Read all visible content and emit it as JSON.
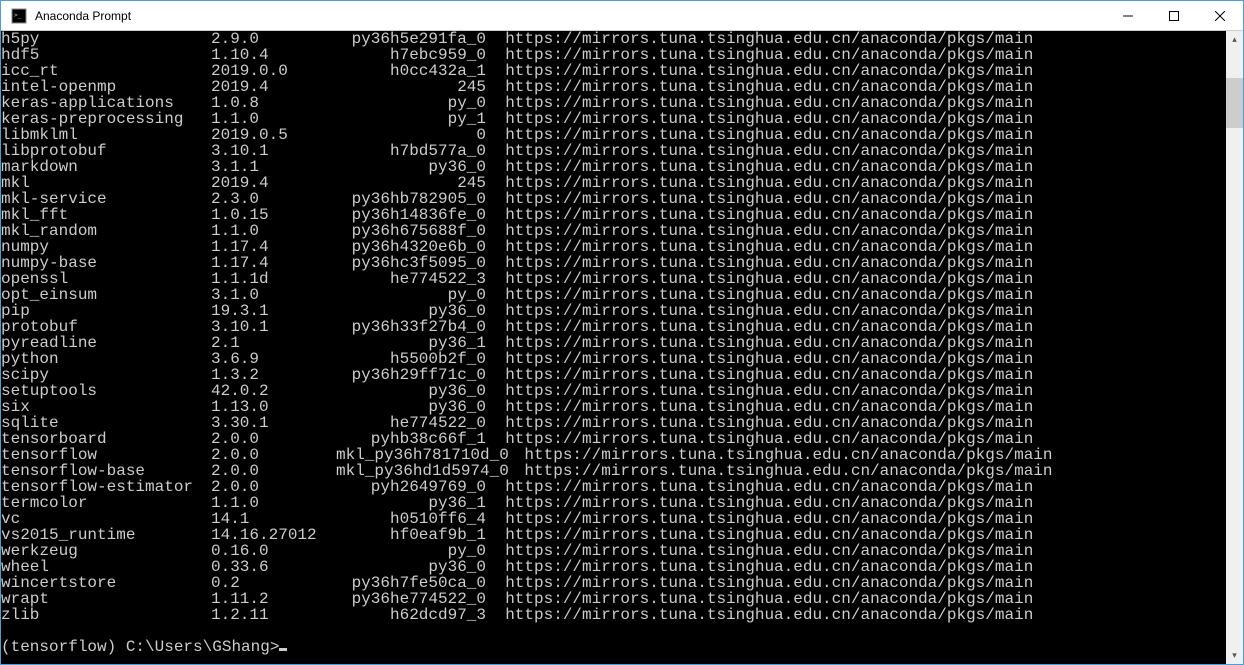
{
  "window": {
    "title": "Anaconda Prompt"
  },
  "packages": [
    {
      "name": "h5py",
      "version": "2.9.0",
      "build": "py36h5e291fa_0",
      "url": "  https://mirrors.tuna.tsinghua.edu.cn/anaconda/pkgs/main"
    },
    {
      "name": "hdf5",
      "version": "1.10.4",
      "build": "h7ebc959_0",
      "url": "  https://mirrors.tuna.tsinghua.edu.cn/anaconda/pkgs/main"
    },
    {
      "name": "icc_rt",
      "version": "2019.0.0",
      "build": "h0cc432a_1",
      "url": "  https://mirrors.tuna.tsinghua.edu.cn/anaconda/pkgs/main"
    },
    {
      "name": "intel-openmp",
      "version": "2019.4",
      "build": "245",
      "url": "  https://mirrors.tuna.tsinghua.edu.cn/anaconda/pkgs/main"
    },
    {
      "name": "keras-applications",
      "version": "1.0.8",
      "build": "py_0",
      "url": "  https://mirrors.tuna.tsinghua.edu.cn/anaconda/pkgs/main"
    },
    {
      "name": "keras-preprocessing",
      "version": "1.1.0",
      "build": "py_1",
      "url": "  https://mirrors.tuna.tsinghua.edu.cn/anaconda/pkgs/main"
    },
    {
      "name": "libmklml",
      "version": "2019.0.5",
      "build": "0",
      "url": "  https://mirrors.tuna.tsinghua.edu.cn/anaconda/pkgs/main"
    },
    {
      "name": "libprotobuf",
      "version": "3.10.1",
      "build": "h7bd577a_0",
      "url": "  https://mirrors.tuna.tsinghua.edu.cn/anaconda/pkgs/main"
    },
    {
      "name": "markdown",
      "version": "3.1.1",
      "build": "py36_0",
      "url": "  https://mirrors.tuna.tsinghua.edu.cn/anaconda/pkgs/main"
    },
    {
      "name": "mkl",
      "version": "2019.4",
      "build": "245",
      "url": "  https://mirrors.tuna.tsinghua.edu.cn/anaconda/pkgs/main"
    },
    {
      "name": "mkl-service",
      "version": "2.3.0",
      "build": "py36hb782905_0",
      "url": "  https://mirrors.tuna.tsinghua.edu.cn/anaconda/pkgs/main"
    },
    {
      "name": "mkl_fft",
      "version": "1.0.15",
      "build": "py36h14836fe_0",
      "url": "  https://mirrors.tuna.tsinghua.edu.cn/anaconda/pkgs/main"
    },
    {
      "name": "mkl_random",
      "version": "1.1.0",
      "build": "py36h675688f_0",
      "url": "  https://mirrors.tuna.tsinghua.edu.cn/anaconda/pkgs/main"
    },
    {
      "name": "numpy",
      "version": "1.17.4",
      "build": "py36h4320e6b_0",
      "url": "  https://mirrors.tuna.tsinghua.edu.cn/anaconda/pkgs/main"
    },
    {
      "name": "numpy-base",
      "version": "1.17.4",
      "build": "py36hc3f5095_0",
      "url": "  https://mirrors.tuna.tsinghua.edu.cn/anaconda/pkgs/main"
    },
    {
      "name": "openssl",
      "version": "1.1.1d",
      "build": "he774522_3",
      "url": "  https://mirrors.tuna.tsinghua.edu.cn/anaconda/pkgs/main"
    },
    {
      "name": "opt_einsum",
      "version": "3.1.0",
      "build": "py_0",
      "url": "  https://mirrors.tuna.tsinghua.edu.cn/anaconda/pkgs/main"
    },
    {
      "name": "pip",
      "version": "19.3.1",
      "build": "py36_0",
      "url": "  https://mirrors.tuna.tsinghua.edu.cn/anaconda/pkgs/main"
    },
    {
      "name": "protobuf",
      "version": "3.10.1",
      "build": "py36h33f27b4_0",
      "url": "  https://mirrors.tuna.tsinghua.edu.cn/anaconda/pkgs/main"
    },
    {
      "name": "pyreadline",
      "version": "2.1",
      "build": "py36_1",
      "url": "  https://mirrors.tuna.tsinghua.edu.cn/anaconda/pkgs/main"
    },
    {
      "name": "python",
      "version": "3.6.9",
      "build": "h5500b2f_0",
      "url": "  https://mirrors.tuna.tsinghua.edu.cn/anaconda/pkgs/main"
    },
    {
      "name": "scipy",
      "version": "1.3.2",
      "build": "py36h29ff71c_0",
      "url": "  https://mirrors.tuna.tsinghua.edu.cn/anaconda/pkgs/main"
    },
    {
      "name": "setuptools",
      "version": "42.0.2",
      "build": "py36_0",
      "url": "  https://mirrors.tuna.tsinghua.edu.cn/anaconda/pkgs/main"
    },
    {
      "name": "six",
      "version": "1.13.0",
      "build": "py36_0",
      "url": "  https://mirrors.tuna.tsinghua.edu.cn/anaconda/pkgs/main"
    },
    {
      "name": "sqlite",
      "version": "3.30.1",
      "build": "he774522_0",
      "url": "  https://mirrors.tuna.tsinghua.edu.cn/anaconda/pkgs/main"
    },
    {
      "name": "tensorboard",
      "version": "2.0.0",
      "build": "pyhb38c66f_1",
      "url": "  https://mirrors.tuna.tsinghua.edu.cn/anaconda/pkgs/main"
    },
    {
      "name": "tensorflow",
      "version": "2.0.0",
      "build": "mkl_py36h781710d_0",
      "url": "    https://mirrors.tuna.tsinghua.edu.cn/anaconda/pkgs/main"
    },
    {
      "name": "tensorflow-base",
      "version": "2.0.0",
      "build": "mkl_py36hd1d5974_0",
      "url": "    https://mirrors.tuna.tsinghua.edu.cn/anaconda/pkgs/main"
    },
    {
      "name": "tensorflow-estimator",
      "version": "2.0.0",
      "build": "pyh2649769_0",
      "url": "  https://mirrors.tuna.tsinghua.edu.cn/anaconda/pkgs/main"
    },
    {
      "name": "termcolor",
      "version": "1.1.0",
      "build": "py36_1",
      "url": "  https://mirrors.tuna.tsinghua.edu.cn/anaconda/pkgs/main"
    },
    {
      "name": "vc",
      "version": "14.1",
      "build": "h0510ff6_4",
      "url": "  https://mirrors.tuna.tsinghua.edu.cn/anaconda/pkgs/main"
    },
    {
      "name": "vs2015_runtime",
      "version": "14.16.27012",
      "build": "hf0eaf9b_1",
      "url": "  https://mirrors.tuna.tsinghua.edu.cn/anaconda/pkgs/main"
    },
    {
      "name": "werkzeug",
      "version": "0.16.0",
      "build": "py_0",
      "url": "  https://mirrors.tuna.tsinghua.edu.cn/anaconda/pkgs/main"
    },
    {
      "name": "wheel",
      "version": "0.33.6",
      "build": "py36_0",
      "url": "  https://mirrors.tuna.tsinghua.edu.cn/anaconda/pkgs/main"
    },
    {
      "name": "wincertstore",
      "version": "0.2",
      "build": "py36h7fe50ca_0",
      "url": "  https://mirrors.tuna.tsinghua.edu.cn/anaconda/pkgs/main"
    },
    {
      "name": "wrapt",
      "version": "1.11.2",
      "build": "py36he774522_0",
      "url": "  https://mirrors.tuna.tsinghua.edu.cn/anaconda/pkgs/main"
    },
    {
      "name": "zlib",
      "version": "1.2.11",
      "build": "h62dcd97_3",
      "url": "  https://mirrors.tuna.tsinghua.edu.cn/anaconda/pkgs/main"
    }
  ],
  "prompt": "(tensorflow) C:\\Users\\GShang>"
}
